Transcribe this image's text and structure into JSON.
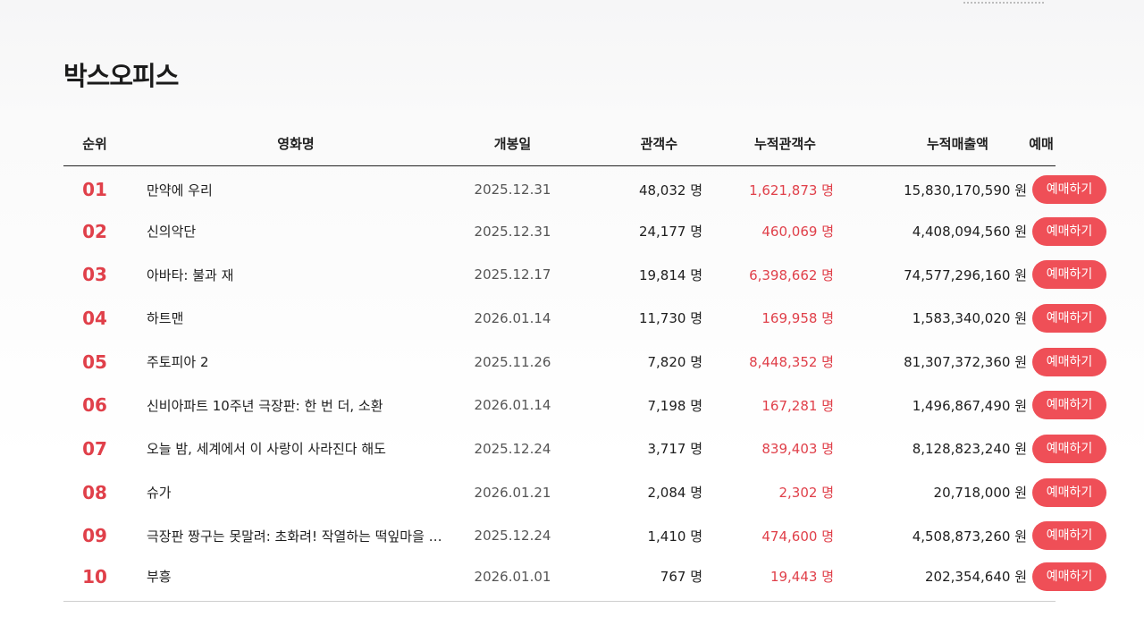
{
  "page": {
    "title": "박스오피스"
  },
  "table": {
    "headers": {
      "rank": "순위",
      "title": "영화명",
      "release": "개봉일",
      "audience": "관객수",
      "cumulative": "누적관객수",
      "revenue": "누적매출액",
      "booking": "예매"
    },
    "rows": [
      {
        "rank": "01",
        "title": "만약에 우리",
        "release": "2025.12.31",
        "audience": "48,032 명",
        "cumulative": "1,621,873 명",
        "revenue": "15,830,170,590 원",
        "button": "예매하기"
      },
      {
        "rank": "02",
        "title": "신의악단",
        "release": "2025.12.31",
        "audience": "24,177 명",
        "cumulative": "460,069 명",
        "revenue": "4,408,094,560 원",
        "button": "예매하기"
      },
      {
        "rank": "03",
        "title": "아바타: 불과 재",
        "release": "2025.12.17",
        "audience": "19,814 명",
        "cumulative": "6,398,662 명",
        "revenue": "74,577,296,160 원",
        "button": "예매하기"
      },
      {
        "rank": "04",
        "title": "하트맨",
        "release": "2026.01.14",
        "audience": "11,730 명",
        "cumulative": "169,958 명",
        "revenue": "1,583,340,020 원",
        "button": "예매하기"
      },
      {
        "rank": "05",
        "title": "주토피아 2",
        "release": "2025.11.26",
        "audience": "7,820 명",
        "cumulative": "8,448,352 명",
        "revenue": "81,307,372,360 원",
        "button": "예매하기"
      },
      {
        "rank": "06",
        "title": "신비아파트 10주년 극장판: 한 번 더, 소환",
        "release": "2026.01.14",
        "audience": "7,198 명",
        "cumulative": "167,281 명",
        "revenue": "1,496,867,490 원",
        "button": "예매하기"
      },
      {
        "rank": "07",
        "title": "오늘 밤, 세계에서 이 사랑이 사라진다 해도",
        "release": "2025.12.24",
        "audience": "3,717 명",
        "cumulative": "839,403 명",
        "revenue": "8,128,823,240 원",
        "button": "예매하기"
      },
      {
        "rank": "08",
        "title": "슈가",
        "release": "2026.01.21",
        "audience": "2,084 명",
        "cumulative": "2,302 명",
        "revenue": "20,718,000 원",
        "button": "예매하기"
      },
      {
        "rank": "09",
        "title": "극장판 짱구는 못말려: 초화려! 작열하는 떡잎마을 …",
        "release": "2025.12.24",
        "audience": "1,410 명",
        "cumulative": "474,600 명",
        "revenue": "4,508,873,260 원",
        "button": "예매하기"
      },
      {
        "rank": "10",
        "title": "부흥",
        "release": "2026.01.01",
        "audience": "767 명",
        "cumulative": "19,443 명",
        "revenue": "202,354,640 원",
        "button": "예매하기"
      }
    ]
  },
  "colors": {
    "accent": "#ef4f57",
    "rank_text": "#e0404a",
    "cumulative_text": "#e0404a"
  }
}
